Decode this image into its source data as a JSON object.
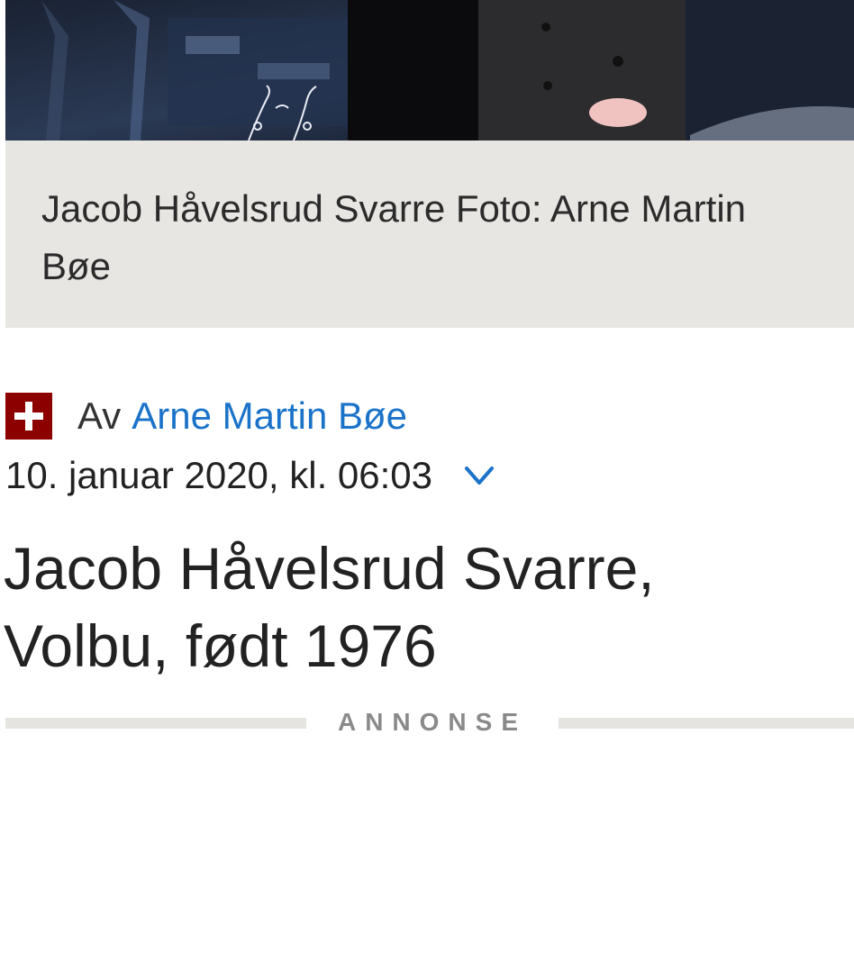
{
  "photo": {
    "caption": "Jacob Håvelsrud Svarre Foto: Arne Martin Bøe"
  },
  "byline": {
    "prefix": "Av",
    "author": "Arne Martin Bøe",
    "flag_icon": "swiss-flag-icon",
    "flag_color": "#8d0000",
    "link_color": "#1a73c9"
  },
  "dateline": {
    "date": "10. januar 2020, kl. 06:03",
    "toggle_icon": "chevron-down-icon"
  },
  "article": {
    "headline": "Jacob Håvelsrud Svarre, Volbu, født 1976"
  },
  "ad": {
    "label": "ANNONSE"
  }
}
